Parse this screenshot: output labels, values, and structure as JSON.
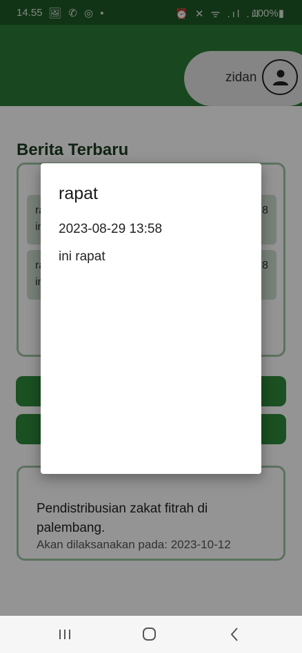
{
  "status_bar": {
    "time": "14.55",
    "left_icons": "🖼 ✆ ◎ •",
    "right_icons": "⏰ ✕ ᯤ .ıl .ıl",
    "battery": "100%▮"
  },
  "header": {
    "username": "zidan",
    "avatar_icon": "person-icon"
  },
  "main": {
    "section_title": "Berita Terbaru",
    "news_items": [
      {
        "left_line1": "ra",
        "right_line1": "8",
        "left_line2": "in"
      },
      {
        "left_line1": "ra",
        "right_line1": "8",
        "left_line2": "in"
      }
    ],
    "event": {
      "title": "Pendistribusian zakat fitrah di palembang.",
      "date": "Akan dilaksanakan pada: 2023-10-12"
    }
  },
  "dialog": {
    "title": "rapat",
    "datetime": "2023-08-29 13:58",
    "body": "ini rapat"
  },
  "colors": {
    "header_green": "#2c7a37",
    "accent_green": "#2f8a3c",
    "border_green": "#9ec4a2"
  }
}
